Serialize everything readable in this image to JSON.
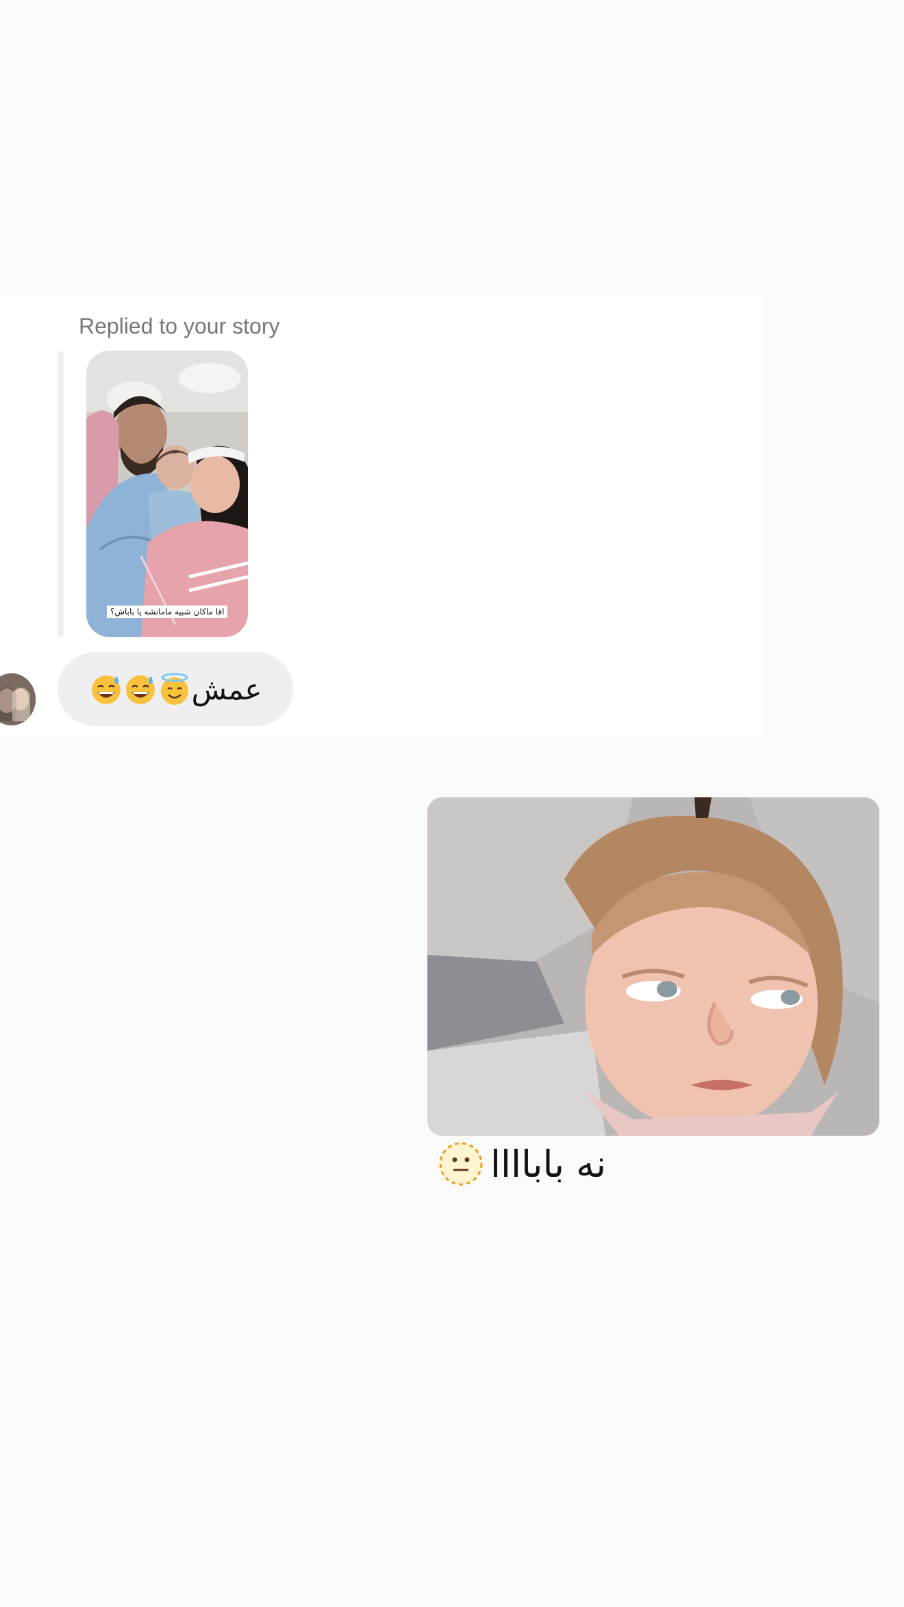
{
  "reply_card": {
    "caption": "Replied to your story",
    "story_caption": "اقا ماکان شبیه مامانشه یا باباش؟"
  },
  "incoming_message": {
    "text": "عمش",
    "emojis": [
      "halo-face-emoji",
      "sweat-smile-emoji",
      "sweat-smile-emoji"
    ]
  },
  "outgoing_message": {
    "gif": "girl-side-eye-gif",
    "text": "نه باباااا",
    "emoji": "dotted-neutral-face-emoji"
  },
  "colors": {
    "background": "#fafafa",
    "card": "#ffffff",
    "bubble": "#efeff1",
    "caption": "#737880",
    "quote_bar": "#efefef"
  }
}
